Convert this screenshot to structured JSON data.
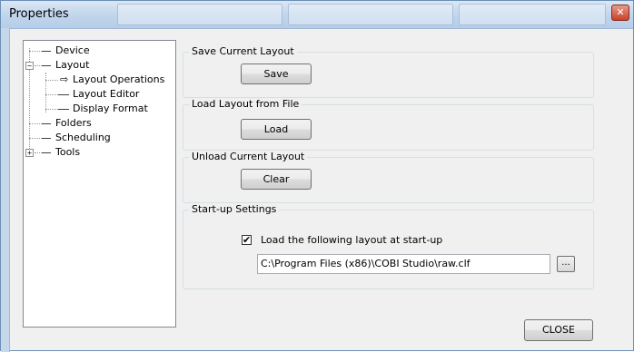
{
  "window": {
    "title": "Properties",
    "close_glyph": "✕"
  },
  "tree": {
    "items": [
      {
        "label": "Device"
      },
      {
        "label": "Layout",
        "expander": "−"
      },
      {
        "label": "Layout Operations"
      },
      {
        "label": "Layout Editor"
      },
      {
        "label": "Display Format"
      },
      {
        "label": "Folders"
      },
      {
        "label": "Scheduling"
      },
      {
        "label": "Tools",
        "expander": "+"
      }
    ],
    "selected_marker": "⇨"
  },
  "groups": {
    "save": {
      "legend": "Save Current Layout",
      "button": "Save"
    },
    "load": {
      "legend": "Load Layout from File",
      "button": "Load"
    },
    "unload": {
      "legend": "Unload Current Layout",
      "button": "Clear"
    },
    "startup": {
      "legend": "Start-up Settings",
      "checkbox_label": "Load the following layout at start-up",
      "checked": true,
      "check_glyph": "✔",
      "path_value": "C:\\Program Files (x86)\\COBI Studio\\raw.clf",
      "browse_label": "..."
    }
  },
  "footer": {
    "close_button": "CLOSE"
  },
  "colors": {
    "titlebar": "#c2d6ec",
    "panel": "#f0f0f0",
    "close_red": "#c9412a"
  }
}
